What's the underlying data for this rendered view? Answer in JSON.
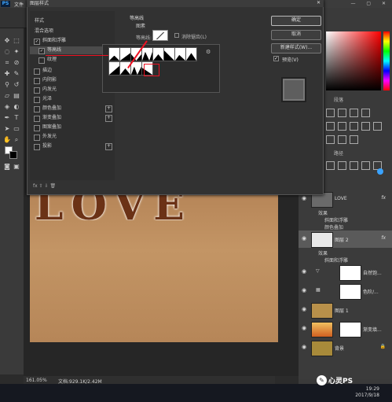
{
  "app": {
    "logo": "PS",
    "menu_file": "文件",
    "window_controls": "— ▢ ✕"
  },
  "dialog": {
    "title": "图层样式",
    "close": "✕",
    "styles": [
      {
        "label": "样式",
        "checkbox": false,
        "checked": false,
        "plus": false,
        "selected": false
      },
      {
        "label": "混合选项",
        "checkbox": false,
        "checked": false,
        "plus": false,
        "selected": false
      },
      {
        "label": "斜面和浮雕",
        "checkbox": true,
        "checked": true,
        "plus": false,
        "selected": false
      },
      {
        "label": "等高线",
        "checkbox": true,
        "checked": true,
        "plus": false,
        "selected": true
      },
      {
        "label": "纹理",
        "checkbox": true,
        "checked": false,
        "plus": false,
        "selected": false
      },
      {
        "label": "描边",
        "checkbox": true,
        "checked": false,
        "plus": true,
        "selected": false
      },
      {
        "label": "内阴影",
        "checkbox": true,
        "checked": false,
        "plus": true,
        "selected": false
      },
      {
        "label": "内发光",
        "checkbox": true,
        "checked": false,
        "plus": false,
        "selected": false
      },
      {
        "label": "光泽",
        "checkbox": true,
        "checked": false,
        "plus": false,
        "selected": false
      },
      {
        "label": "颜色叠加",
        "checkbox": true,
        "checked": false,
        "plus": true,
        "selected": false
      },
      {
        "label": "渐变叠加",
        "checkbox": true,
        "checked": false,
        "plus": true,
        "selected": false
      },
      {
        "label": "图案叠加",
        "checkbox": true,
        "checked": false,
        "plus": false,
        "selected": false
      },
      {
        "label": "外发光",
        "checkbox": true,
        "checked": false,
        "plus": false,
        "selected": false
      },
      {
        "label": "投影",
        "checkbox": true,
        "checked": false,
        "plus": true,
        "selected": false
      }
    ],
    "fx_bar": "fx  ⇧  ⇩                                    🗑",
    "section_title": "等高线",
    "section_sub": "图素",
    "contour_label": "等高线:",
    "antialias_label": "消除锯齿(L)",
    "range_label": "范",
    "buttons": {
      "ok": "确定",
      "cancel": "取消",
      "new_style": "新建样式(W)..."
    },
    "preview_label": "预览(V)",
    "gear": "⚙"
  },
  "panels": {
    "tab_a": "段落",
    "tab_b": "路径"
  },
  "layers": [
    {
      "name": "LOVE",
      "fx": "fx",
      "thumb": "#6a6a6a",
      "effects": [
        "效果",
        "斜面和浮雕",
        "颜色叠加"
      ]
    },
    {
      "name": "图层 2",
      "fx": "fx",
      "thumb": "#e8e8e8",
      "effects": [
        "效果",
        "斜面和浮雕"
      ],
      "selected": true
    },
    {
      "name": "自然饱...",
      "fx": "",
      "thumb": "#3a3a3a"
    },
    {
      "name": "色阶/...",
      "fx": "",
      "thumb": "#3a3a3a"
    },
    {
      "name": "图层 1",
      "fx": "",
      "thumb": "#b8904a"
    },
    {
      "name": "渐变填...",
      "fx": "",
      "thumb": "#e0a040"
    },
    {
      "name": "背景",
      "fx": "",
      "thumb": "#a88a3a",
      "lock": "🔒"
    }
  ],
  "canvas": {
    "love_text": "LOVE"
  },
  "status": {
    "zoom": "161.05%",
    "doc": "文档:929.1K/2.42M"
  },
  "taskbar": {
    "time": "19:29",
    "date": "2017/9/18"
  },
  "watermark": {
    "icon": "✎",
    "text": "心灵PS"
  }
}
